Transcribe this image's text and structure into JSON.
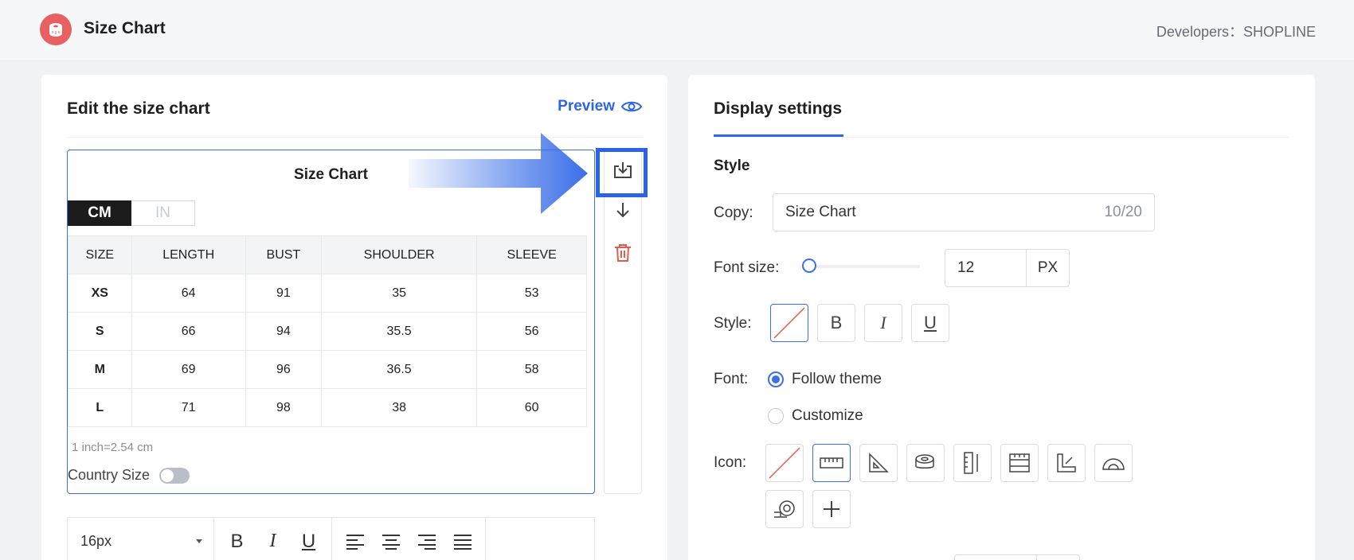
{
  "header": {
    "app_title": "Size Chart",
    "developers": "Developers：SHOPLINE"
  },
  "editor": {
    "title": "Edit the size chart",
    "preview_label": "Preview",
    "chart_title": "Size Chart",
    "units": [
      "CM",
      "IN"
    ],
    "active_unit": "CM",
    "columns": [
      "SIZE",
      "LENGTH",
      "BUST",
      "SHOULDER",
      "SLEEVE"
    ],
    "rows": [
      [
        "XS",
        "64",
        "91",
        "35",
        "53"
      ],
      [
        "S",
        "66",
        "94",
        "35.5",
        "56"
      ],
      [
        "M",
        "69",
        "96",
        "36.5",
        "58"
      ],
      [
        "L",
        "71",
        "98",
        "38",
        "60"
      ]
    ],
    "note": "1 inch=2.54 cm",
    "country_size_label": "Country Size",
    "country_size_enabled": false,
    "side_tools": [
      "import-icon",
      "move-down-icon",
      "delete-icon"
    ],
    "toolbar": {
      "font_size": "16px",
      "format_buttons": [
        "B",
        "I",
        "U"
      ],
      "align_icons": [
        "align-left-icon",
        "align-center-icon",
        "align-right-icon",
        "align-justify-icon"
      ]
    }
  },
  "settings": {
    "tab_label": "Display settings",
    "section_style": "Style",
    "copy_label": "Copy:",
    "copy_value": "Size Chart",
    "copy_count": "10/20",
    "font_size_label": "Font size:",
    "font_size_value": "12",
    "font_size_unit": "PX",
    "style_label": "Style:",
    "style_buttons": [
      "B",
      "I",
      "U"
    ],
    "font_label": "Font:",
    "font_options": [
      "Follow theme",
      "Customize"
    ],
    "font_selected": "Follow theme",
    "icon_label": "Icon:",
    "icons": [
      "none-icon",
      "ruler-icon",
      "set-square-icon",
      "tape-measure-icon",
      "vertical-ruler-icon",
      "fabric-ruler-icon",
      "angle-ruler-icon",
      "protractor-icon",
      "measuring-tape-icon",
      "add-icon"
    ],
    "icon_selected": "ruler-icon"
  },
  "colors": {
    "accent": "#2f66e6",
    "highlight": "#2a62e8",
    "logo": "#e8605f",
    "delete": "#e35d4f"
  }
}
